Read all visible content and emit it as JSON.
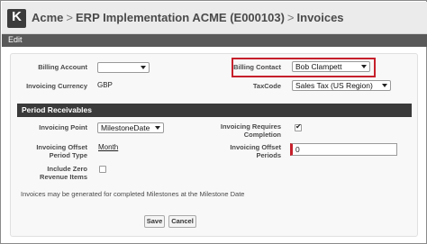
{
  "breadcrumb": {
    "root": "Acme",
    "project": "ERP Implementation ACME (E000103)",
    "page": "Invoices",
    "separator": ">"
  },
  "logo_letter": "K",
  "edit_bar": {
    "label": "Edit"
  },
  "form": {
    "billing_account": {
      "label": "Billing Account",
      "value": ""
    },
    "billing_contact": {
      "label": "Billing Contact",
      "value": "Bob Clampett"
    },
    "invoicing_currency": {
      "label": "Invoicing Currency",
      "value": "GBP"
    },
    "tax_code": {
      "label": "TaxCode",
      "value": "Sales Tax (US Region)"
    }
  },
  "period_section": {
    "title": "Period Receivables",
    "invoicing_point": {
      "label": "Invoicing Point",
      "value": "MilestoneDate"
    },
    "requires_completion": {
      "label_line1": "Invoicing Requires",
      "label_line2": "Completion",
      "checked": true
    },
    "offset_period_type": {
      "label_line1": "Invoicing Offset",
      "label_line2": "Period Type",
      "value": "Month"
    },
    "offset_periods": {
      "label_line1": "Invoicing Offset",
      "label_line2": "Periods",
      "value": "0"
    },
    "include_zero": {
      "label_line1": "Include Zero",
      "label_line2": "Revenue Items",
      "checked": false
    }
  },
  "note": "Invoices may be generated for completed Milestones at the Milestone Date",
  "buttons": {
    "save": "Save",
    "cancel": "Cancel"
  },
  "colors": {
    "highlight": "#c6202b",
    "header_bg": "#ebebeb",
    "edit_bar": "#595959",
    "section_bar": "#3a3a3a"
  }
}
